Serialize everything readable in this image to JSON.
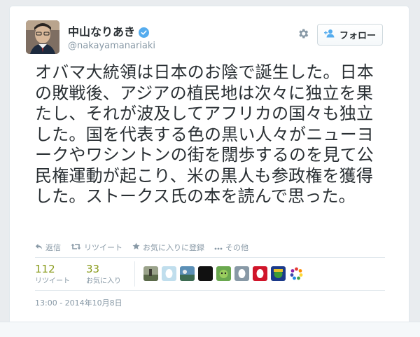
{
  "tweet": {
    "author_name": "中山なりあき",
    "handle": "@nakayamanariaki",
    "follow_label": "フォロー",
    "text": "オバマ大統領は日本のお陰で誕生した。日本の敗戦後、アジアの植民地は次々に独立を果たし、それが波及してアフリカの国々も独立した。国を代表する色の黒い人々がニューヨークやワシントンの街を闊歩するのを見て公民権運動が起こり、米の黒人も参政権を獲得した。ストークス氏の本を読んで思った。",
    "actions": {
      "reply": "返信",
      "retweet": "リツイート",
      "favorite": "お気に入りに登録",
      "more": "その他"
    },
    "stats": {
      "retweets": {
        "count": "112",
        "label": "リツイート"
      },
      "favorites": {
        "count": "33",
        "label": "お気に入り"
      }
    },
    "timestamp": "13:00 - 2014年10月8日"
  },
  "colors": {
    "accent": "#55acee",
    "stat_number": "#899b1b",
    "muted": "#8899a6",
    "text": "#292f33"
  },
  "icons": [
    "verified-badge-icon",
    "gear-icon",
    "follow-person-icon",
    "reply-icon",
    "retweet-icon",
    "star-icon",
    "more-dots-icon"
  ]
}
